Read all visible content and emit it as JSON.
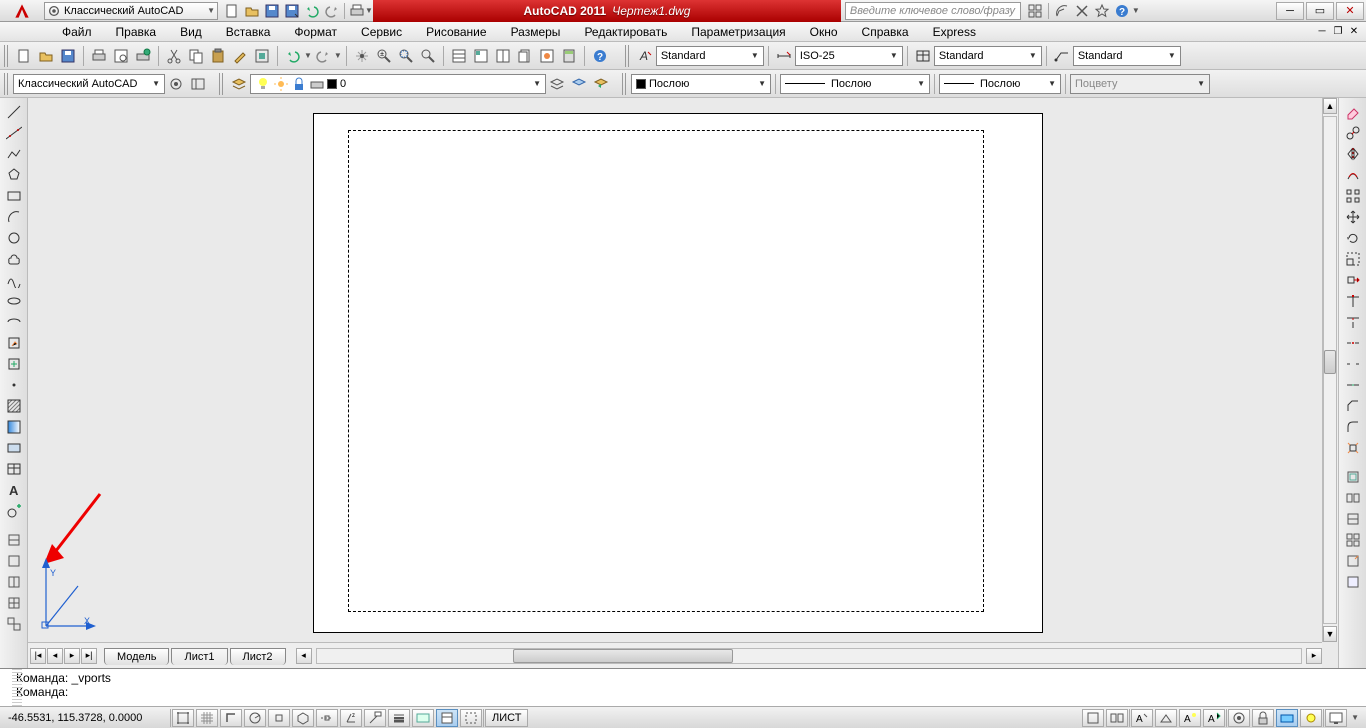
{
  "title": {
    "app": "AutoCAD 2011",
    "file": "Чертеж1.dwg"
  },
  "workspace_dd": "Классический AutoCAD",
  "search_placeholder": "Введите ключевое слово/фразу",
  "menu": [
    "Файл",
    "Правка",
    "Вид",
    "Вставка",
    "Формат",
    "Сервис",
    "Рисование",
    "Размеры",
    "Редактировать",
    "Параметризация",
    "Окно",
    "Справка",
    "Express"
  ],
  "row1": {
    "text_style": "Standard",
    "dim_style": "ISO-25",
    "table_style": "Standard",
    "mleader_style": "Standard"
  },
  "row2": {
    "workspace": "Классический AutoCAD",
    "layer": "0",
    "color": "Послою",
    "linetype": "Послою",
    "lineweight": "Послою",
    "plotstyle": "Поцвету"
  },
  "tabs": {
    "model": "Модель",
    "sheet1": "Лист1",
    "sheet2": "Лист2"
  },
  "cmd": {
    "l1": "Команда: _vports",
    "l2": "Команда:"
  },
  "status": {
    "coords": "-46.5531, 115.3728, 0.0000",
    "space": "ЛИСТ"
  }
}
